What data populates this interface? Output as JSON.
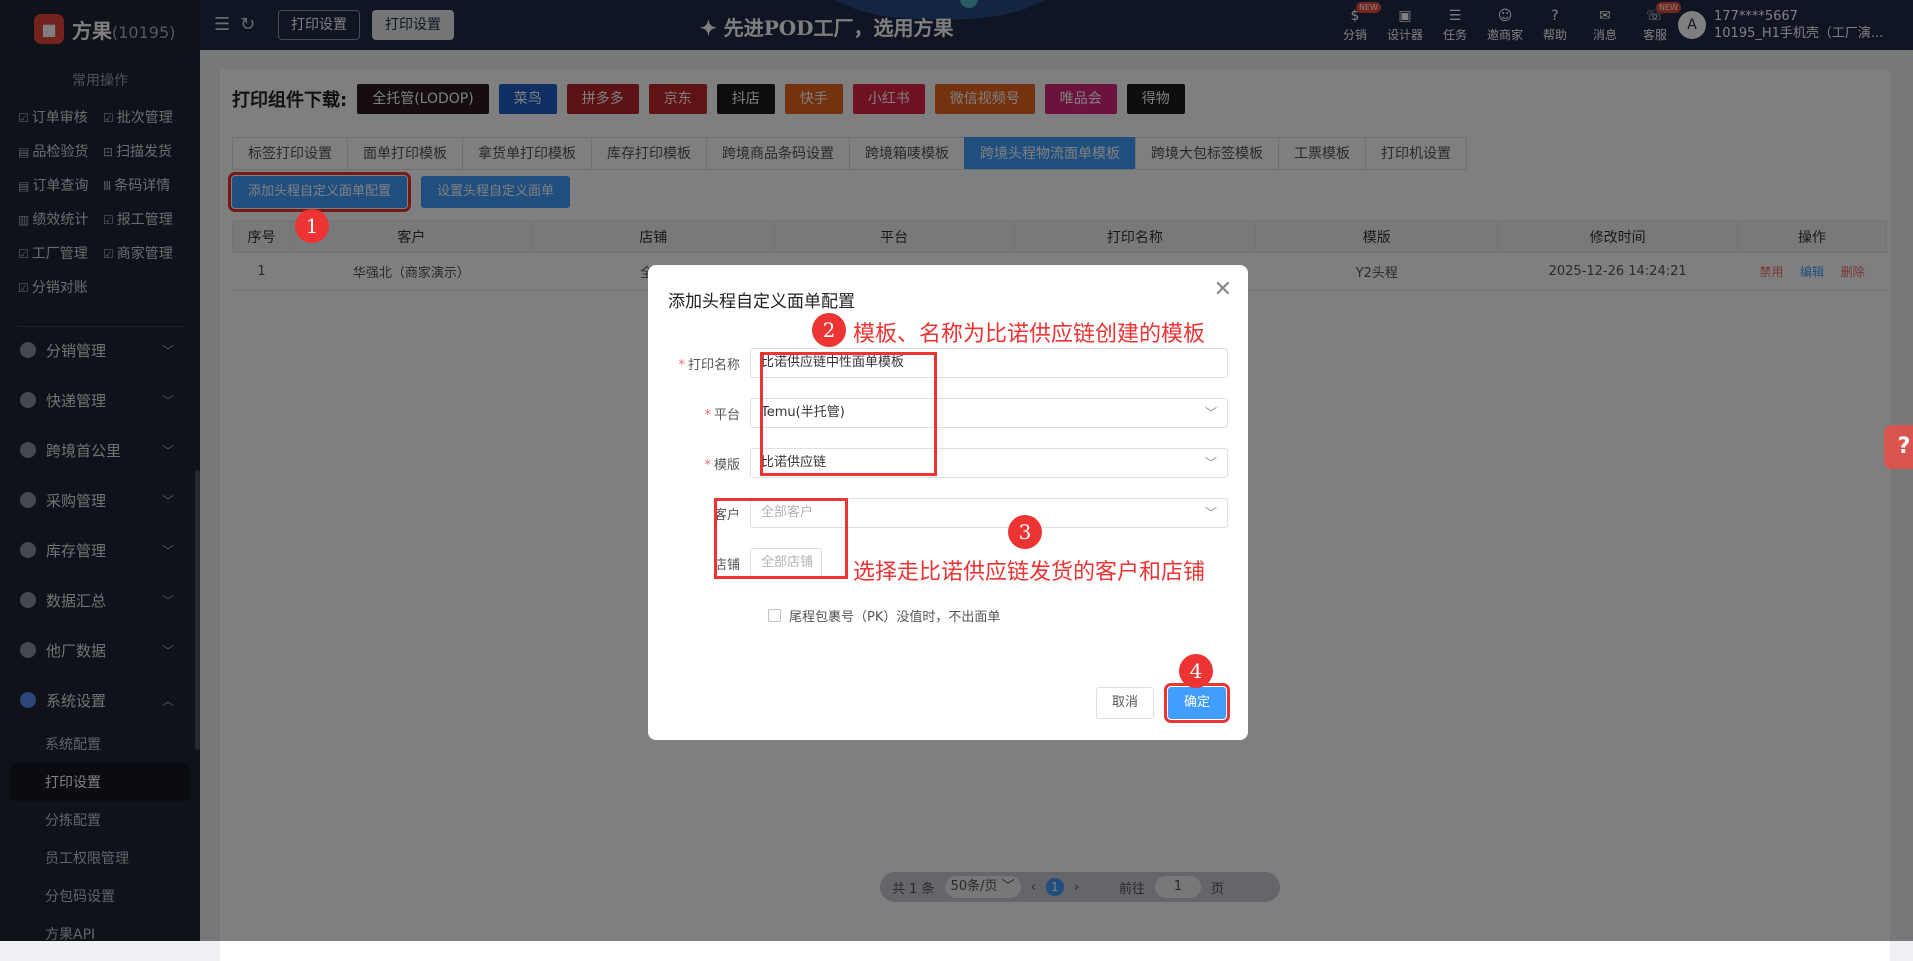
{
  "sidebar": {
    "brand": "方果",
    "brand_count": "(10195)",
    "section_title": "常用操作",
    "quick_rows": [
      [
        "订单审核",
        "批次管理"
      ],
      [
        "品检验货",
        "扫描发货"
      ],
      [
        "订单查询",
        "条码详情"
      ],
      [
        "绩效统计",
        "报工管理"
      ],
      [
        "工厂管理",
        "商家管理"
      ],
      [
        "分销对账",
        ""
      ]
    ],
    "menu": [
      {
        "label": "分销管理",
        "chev": "﹀"
      },
      {
        "label": "快递管理",
        "chev": "﹀"
      },
      {
        "label": "跨境首公里",
        "chev": "﹀"
      },
      {
        "label": "采购管理",
        "chev": "﹀"
      },
      {
        "label": "库存管理",
        "chev": "﹀"
      },
      {
        "label": "数据汇总",
        "chev": "﹀"
      },
      {
        "label": "他厂数据",
        "chev": "﹀"
      },
      {
        "label": "系统设置",
        "chev": "︿"
      }
    ],
    "sub_items": [
      "系统配置",
      "打印设置",
      "分拣配置",
      "员工权限管理",
      "分包码设置",
      "方果API"
    ]
  },
  "topbar": {
    "tab1": "打印设置",
    "tab2": "打印设置",
    "slogan": "✦ 先进POD工厂，选用方果",
    "icons": [
      {
        "label": "分销",
        "icon": "money-icon",
        "glyph": "$",
        "new": "NEW"
      },
      {
        "label": "设计器",
        "icon": "image-icon",
        "glyph": "▣",
        "new": ""
      },
      {
        "label": "任务",
        "icon": "task-icon",
        "glyph": "☰",
        "new": ""
      },
      {
        "label": "邀商家",
        "icon": "invite-icon",
        "glyph": "☺",
        "new": ""
      },
      {
        "label": "帮助",
        "icon": "help-icon",
        "glyph": "?",
        "new": ""
      },
      {
        "label": "消息",
        "icon": "message-icon",
        "glyph": "✉",
        "new": ""
      },
      {
        "label": "客服",
        "icon": "service-icon",
        "glyph": "☏",
        "new": "NEW"
      }
    ],
    "user_phone": "177****5667",
    "user_org": "10195_H1手机壳（工厂演..."
  },
  "page": {
    "download_label": "打印组件下载:",
    "download_buttons": [
      {
        "label": "全托管(LODOP)",
        "color": "#2a1a22"
      },
      {
        "label": "菜鸟",
        "color": "#1e5fc8"
      },
      {
        "label": "拼多多",
        "color": "#b8262c"
      },
      {
        "label": "京东",
        "color": "#c0262b"
      },
      {
        "label": "抖店",
        "color": "#1b1b1b"
      },
      {
        "label": "快手",
        "color": "#e8651e"
      },
      {
        "label": "小红书",
        "color": "#dd2548"
      },
      {
        "label": "微信视频号",
        "color": "#e8651e"
      },
      {
        "label": "唯品会",
        "color": "#d7277a"
      },
      {
        "label": "得物",
        "color": "#1b1b1b"
      }
    ],
    "tabs": [
      "标签打印设置",
      "面单打印模板",
      "拿货单打印模板",
      "库存打印模板",
      "跨境商品条码设置",
      "跨境箱唛模板",
      "跨境头程物流面单模板",
      "跨境大包标签模板",
      "工票模板",
      "打印机设置"
    ],
    "active_tab": 6,
    "btn_add": "添加头程自定义面单配置",
    "btn_set": "设置头程自定义面单",
    "columns": [
      "序号",
      "客户",
      "店铺",
      "平台",
      "打印名称",
      "模版",
      "修改时间",
      "操作"
    ],
    "rows": [
      {
        "no": "1",
        "customer": "华强北（商家演示）",
        "shop": "全部",
        "platform": "",
        "print_name": "",
        "template": "Y2头程",
        "time": "2025-12-26 14:24:21",
        "op1": "禁用",
        "op2": "编辑",
        "op3": "删除"
      }
    ],
    "pager": {
      "total": "共 1 条",
      "size": "50条/页 ﹀",
      "prev": "‹",
      "page": "1",
      "next": "›",
      "goto": "前往",
      "goto_val": "1",
      "unit": "页"
    }
  },
  "dialog": {
    "title": "添加头程自定义面单配置",
    "close": "✕",
    "fields": {
      "print_name_label": "打印名称",
      "print_name_value": "比诺供应链中性面单模板",
      "platform_label": "平台",
      "platform_value": "Temu(半托管)",
      "template_label": "模版",
      "template_value": "比诺供应链",
      "customer_label": "客户",
      "customer_placeholder": "全部客户",
      "shop_label": "店铺",
      "shop_placeholder": "全部店铺"
    },
    "checkbox_label": "尾程包裹号（PK）没值时，不出面单",
    "cancel": "取消",
    "ok": "确定"
  },
  "annotations": {
    "n1": "1",
    "n2": "2",
    "n3": "3",
    "n4": "4",
    "text2": "模板、名称为比诺供应链创建的模板",
    "text3": "选择走比诺供应链发货的客户和店铺"
  },
  "help_float": "?"
}
